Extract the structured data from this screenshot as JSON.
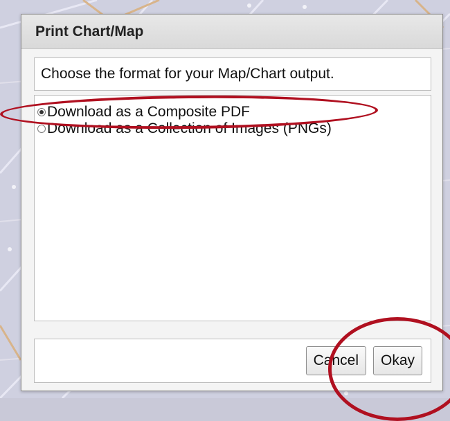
{
  "dialog": {
    "title": "Print Chart/Map",
    "prompt": "Choose the format for your Map/Chart output.",
    "options": [
      {
        "label": "Download as a Composite PDF",
        "checked": true
      },
      {
        "label": "Download as a Collection of Images (PNGs)",
        "checked": false
      }
    ],
    "buttons": {
      "cancel": "Cancel",
      "okay": "Okay"
    }
  },
  "colors": {
    "annotation": "#b01020",
    "background_map": "#c9c9d8"
  }
}
